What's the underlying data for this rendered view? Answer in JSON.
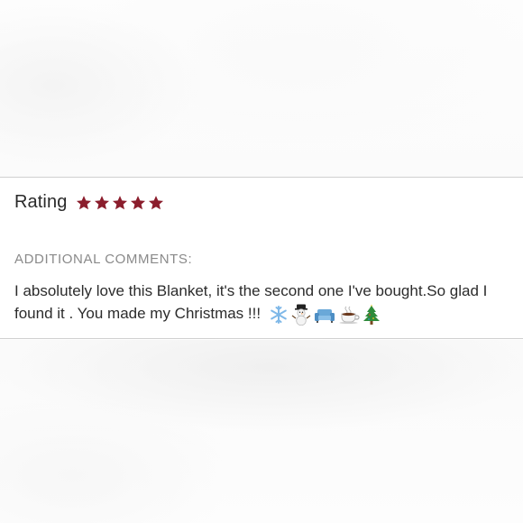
{
  "review": {
    "rating_label": "Rating",
    "rating_value": 5,
    "rating_max": 5,
    "star_color": "#8b1d2c",
    "comments_label": "ADDITIONAL COMMENTS:",
    "comment_text": "I absolutely love this Blanket, it's the second one I've bought.So glad I found it . You made my Christmas !!!",
    "comment_emojis": [
      "snowflake-icon",
      "snowman-icon",
      "couch-icon",
      "coffee-icon",
      "christmas-tree-icon"
    ]
  }
}
